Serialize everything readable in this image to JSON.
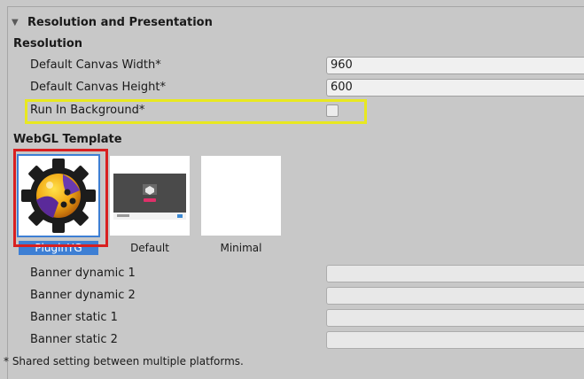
{
  "section": {
    "title": "Resolution and Presentation"
  },
  "resolution": {
    "heading": "Resolution",
    "fields": [
      {
        "label": "Default Canvas Width*",
        "value": "960"
      },
      {
        "label": "Default Canvas Height*",
        "value": "600"
      }
    ],
    "run_in_background": {
      "label": "Run In Background*",
      "checked": false
    }
  },
  "webgl": {
    "heading": "WebGL Template",
    "templates": [
      {
        "name": "PluginYG",
        "selected": true
      },
      {
        "name": "Default",
        "selected": false
      },
      {
        "name": "Minimal",
        "selected": false
      }
    ]
  },
  "banners": [
    {
      "label": "Banner dynamic 1",
      "value": ""
    },
    {
      "label": "Banner dynamic 2",
      "value": ""
    },
    {
      "label": "Banner static 1",
      "value": ""
    },
    {
      "label": "Banner static 2",
      "value": ""
    }
  ],
  "footnote": "* Shared setting between multiple platforms.",
  "colors": {
    "selection": "#3d7fd4",
    "highlight_yellow": "#e8e820",
    "highlight_red": "#d82020"
  }
}
